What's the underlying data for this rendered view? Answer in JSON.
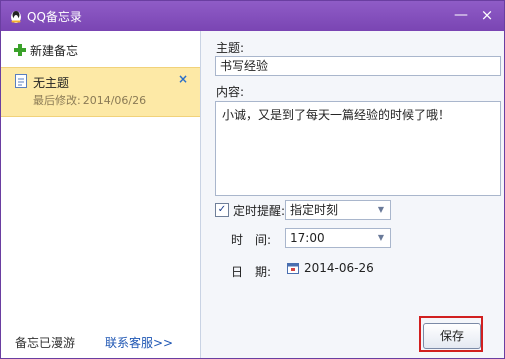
{
  "window": {
    "title": "QQ备忘录",
    "minimize": "—",
    "close": "×"
  },
  "sidebar": {
    "new_note": "新建备忘",
    "note": {
      "title": "无主题",
      "meta_label": "最后修改:",
      "meta_date": "2014/06/26",
      "delete": "×"
    },
    "footer": {
      "roaming": "备忘已漫游",
      "support": "联系客服>>"
    }
  },
  "editor": {
    "subject_label": "主题:",
    "subject_value": "书写经验",
    "content_label": "内容:",
    "content_value": "小诚，又是到了每天一篇经验的时候了哦！",
    "reminder_checked": "✓",
    "reminder_label": "定时提醒:",
    "reminder_mode": "指定时刻",
    "time_label": "时　间:",
    "time_value": "17:00",
    "date_label": "日　期:",
    "date_value": "2014-06-26",
    "save": "保存"
  },
  "colors": {
    "titlebar": "#7a45b3",
    "selected_note": "#fde9a6",
    "highlight": "#d11f1f",
    "link": "#1e56b3"
  },
  "icons": [
    "qq-penguin-icon",
    "plus-icon",
    "document-icon",
    "calendar-icon",
    "checkbox-checked-icon",
    "dropdown-arrow-icon"
  ]
}
